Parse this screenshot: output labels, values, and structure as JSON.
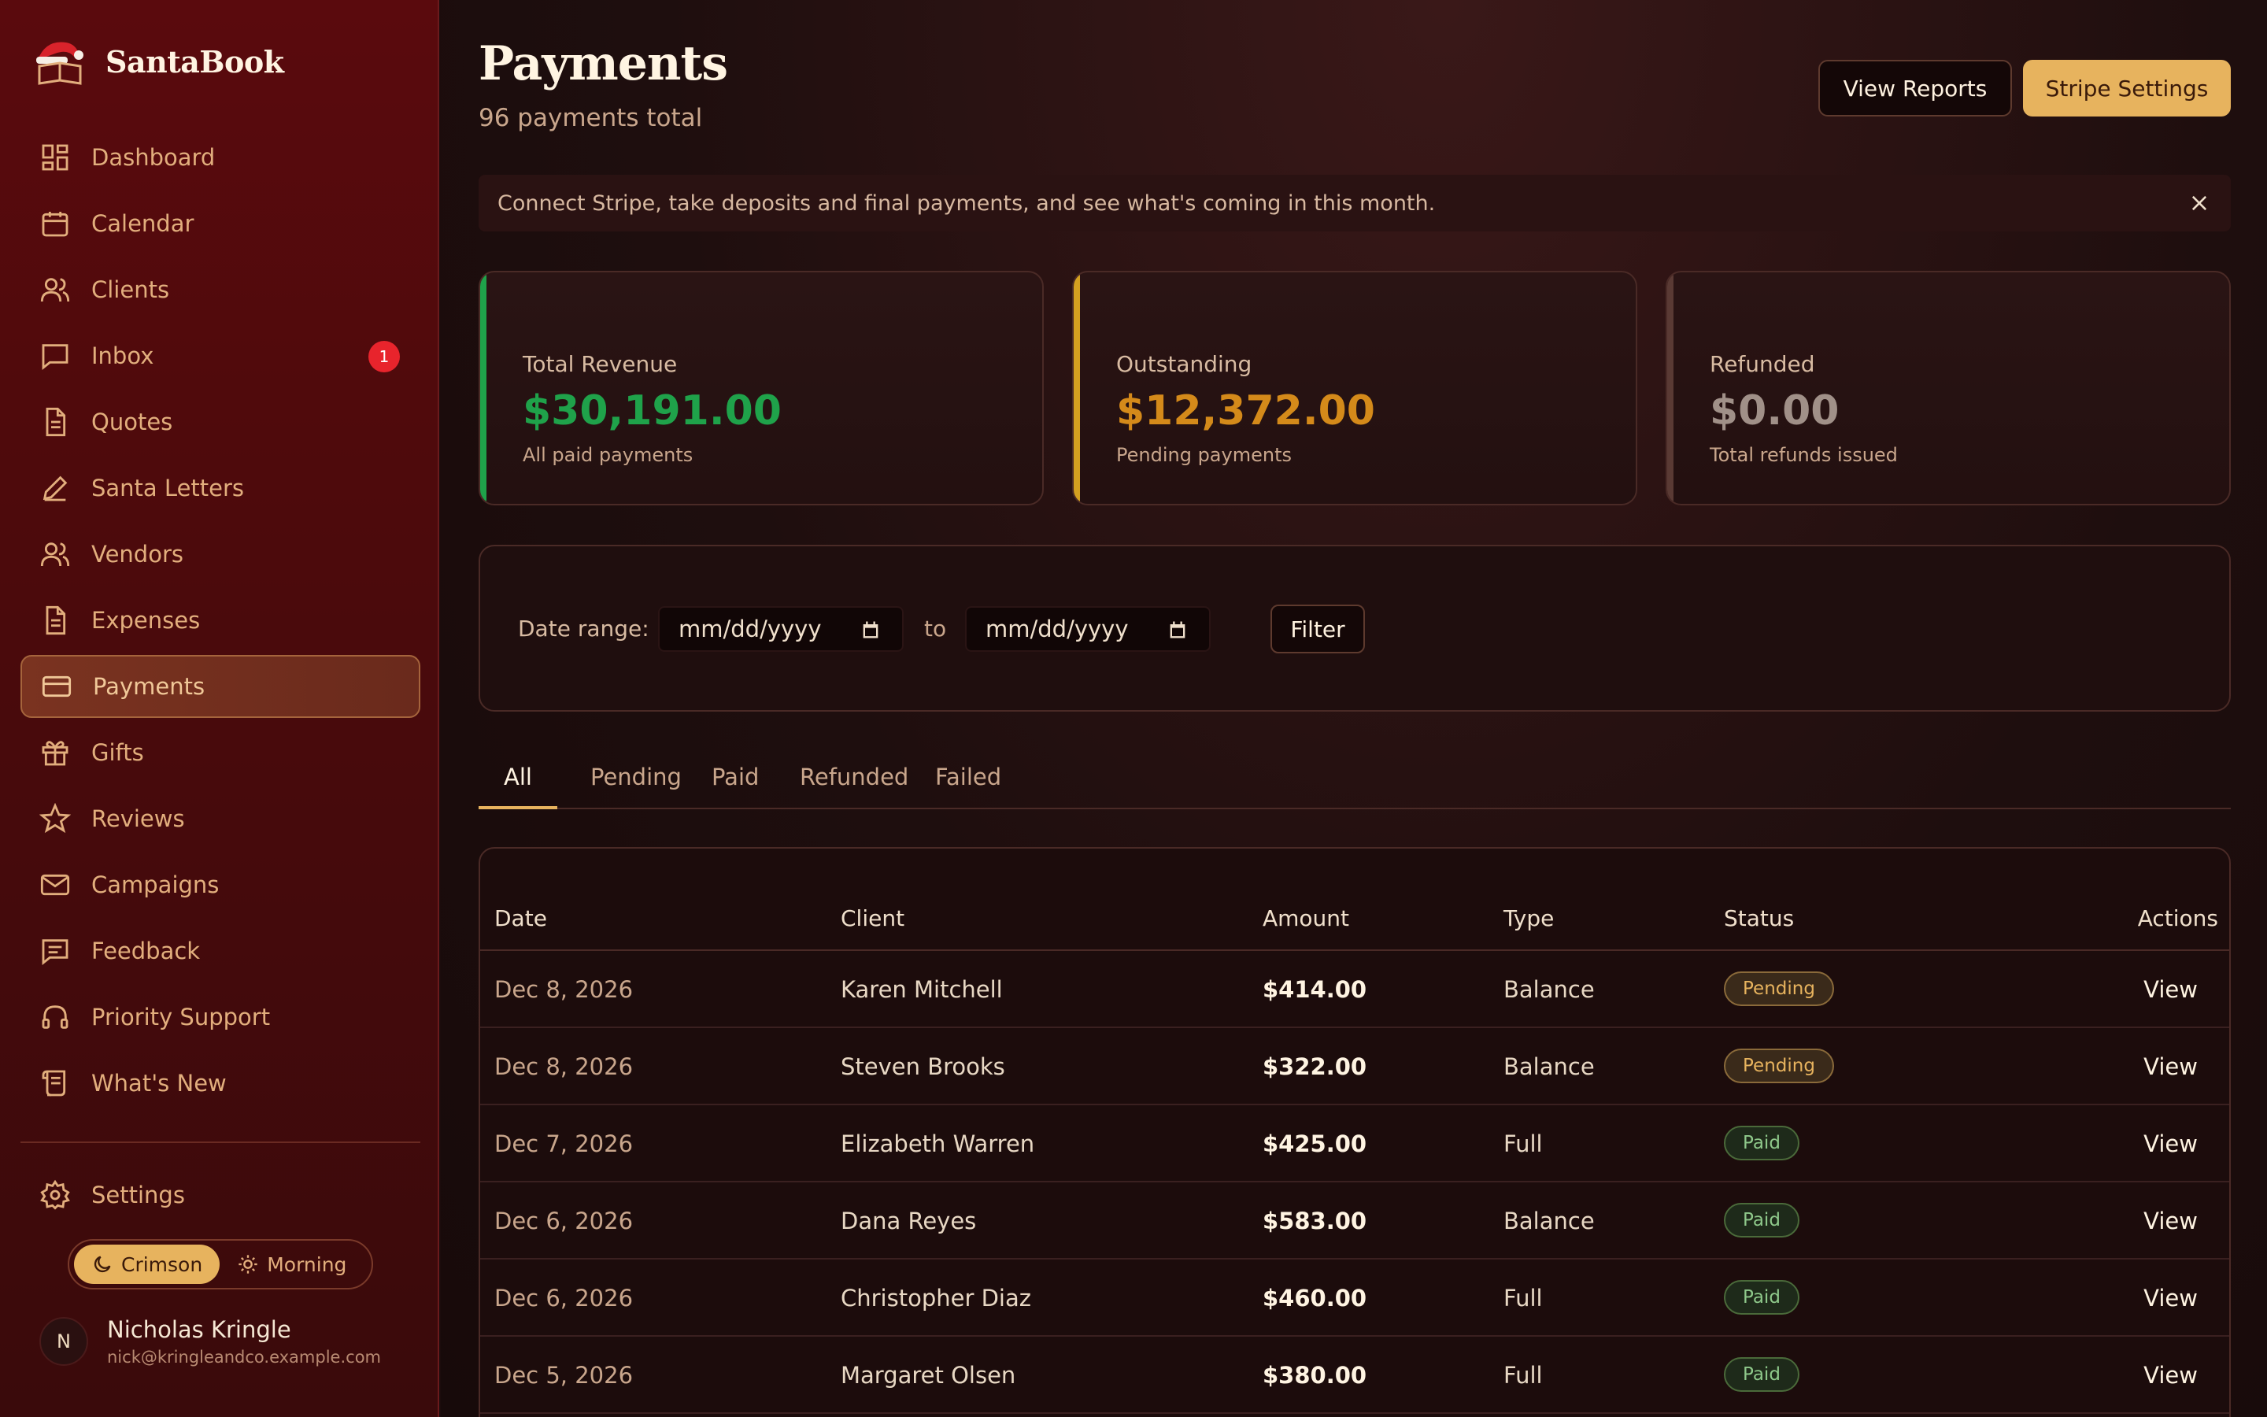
{
  "brand": {
    "name": "SantaBook"
  },
  "sidebar": {
    "items": [
      {
        "label": "Dashboard",
        "icon": "dashboard-icon"
      },
      {
        "label": "Calendar",
        "icon": "calendar-icon"
      },
      {
        "label": "Clients",
        "icon": "users-icon"
      },
      {
        "label": "Inbox",
        "icon": "message-icon",
        "badge": "1"
      },
      {
        "label": "Quotes",
        "icon": "document-icon"
      },
      {
        "label": "Santa Letters",
        "icon": "pen-icon"
      },
      {
        "label": "Vendors",
        "icon": "users-icon"
      },
      {
        "label": "Expenses",
        "icon": "document-icon"
      },
      {
        "label": "Payments",
        "icon": "credit-card-icon",
        "active": true
      },
      {
        "label": "Gifts",
        "icon": "gift-icon"
      },
      {
        "label": "Reviews",
        "icon": "star-icon"
      },
      {
        "label": "Campaigns",
        "icon": "mail-icon"
      },
      {
        "label": "Feedback",
        "icon": "feedback-icon"
      },
      {
        "label": "Priority Support",
        "icon": "headset-icon"
      },
      {
        "label": "What's New",
        "icon": "scroll-icon"
      }
    ],
    "settings_label": "Settings",
    "theme": {
      "dark_label": "Crimson",
      "light_label": "Morning",
      "selected": "Crimson"
    },
    "user": {
      "initial": "N",
      "name": "Nicholas Kringle",
      "email": "nick@kringleandco.example.com"
    }
  },
  "header": {
    "title": "Payments",
    "subtitle": "96 payments total",
    "reports_label": "View Reports",
    "stripe_label": "Stripe Settings"
  },
  "banner": {
    "text": "Connect Stripe, take deposits and final payments, and see what's coming in this month."
  },
  "stats": [
    {
      "label": "Total Revenue",
      "value": "$30,191.00",
      "note": "All paid payments",
      "color": "#1fa24a"
    },
    {
      "label": "Outstanding",
      "value": "$12,372.00",
      "note": "Pending payments",
      "color": "#d48a1a"
    },
    {
      "label": "Refunded",
      "value": "$0.00",
      "note": "Total refunds issued",
      "color": "#a09088"
    }
  ],
  "filter": {
    "label": "Date range:",
    "from_placeholder": "mm/dd/yyyy",
    "to_label": "to",
    "to_placeholder": "mm/dd/yyyy",
    "button_label": "Filter"
  },
  "tabs": [
    {
      "label": "All",
      "active": true
    },
    {
      "label": "Pending"
    },
    {
      "label": "Paid"
    },
    {
      "label": "Refunded"
    },
    {
      "label": "Failed"
    }
  ],
  "table": {
    "headers": {
      "date": "Date",
      "client": "Client",
      "amount": "Amount",
      "type": "Type",
      "status": "Status",
      "actions": "Actions"
    },
    "rows": [
      {
        "date": "Dec 8, 2026",
        "client": "Karen Mitchell",
        "amount": "$414.00",
        "type": "Balance",
        "status": "Pending",
        "action": "View"
      },
      {
        "date": "Dec 8, 2026",
        "client": "Steven Brooks",
        "amount": "$322.00",
        "type": "Balance",
        "status": "Pending",
        "action": "View"
      },
      {
        "date": "Dec 7, 2026",
        "client": "Elizabeth Warren",
        "amount": "$425.00",
        "type": "Full",
        "status": "Paid",
        "action": "View"
      },
      {
        "date": "Dec 6, 2026",
        "client": "Dana Reyes",
        "amount": "$583.00",
        "type": "Balance",
        "status": "Paid",
        "action": "View"
      },
      {
        "date": "Dec 6, 2026",
        "client": "Christopher Diaz",
        "amount": "$460.00",
        "type": "Full",
        "status": "Paid",
        "action": "View"
      },
      {
        "date": "Dec 5, 2026",
        "client": "Margaret Olsen",
        "amount": "$380.00",
        "type": "Full",
        "status": "Paid",
        "action": "View"
      }
    ]
  }
}
